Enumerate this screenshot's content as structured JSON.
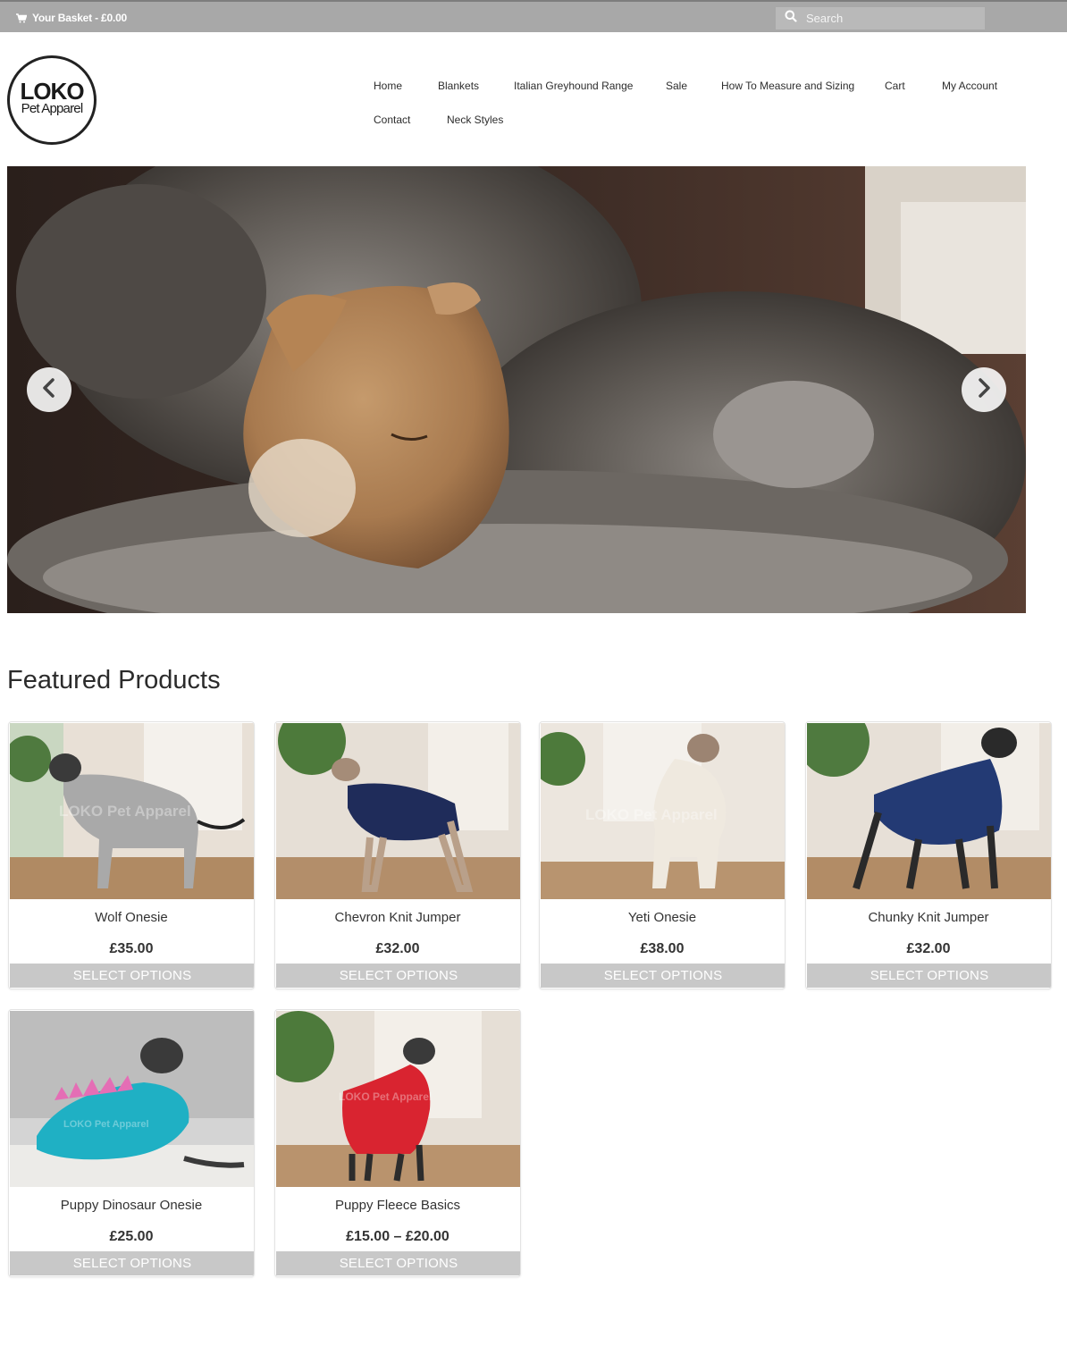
{
  "topbar": {
    "basket_label": "Your Basket - £0.00",
    "search_placeholder": "Search"
  },
  "logo": {
    "line1": "LOKO",
    "line2": "Pet Apparel"
  },
  "nav": {
    "items": [
      "Home",
      "Blankets",
      "Italian Greyhound Range",
      "Sale",
      "How To Measure and Sizing",
      "Cart",
      "My Account",
      "Contact",
      "Neck Styles"
    ]
  },
  "hero": {
    "prev_icon": "chevron-left-icon",
    "next_icon": "chevron-right-icon"
  },
  "featured": {
    "title": "Featured Products",
    "button_label": "SELECT OPTIONS",
    "watermark": "LOKO Pet Apparel",
    "products": [
      {
        "name": "Wolf Onesie",
        "price": "£35.00",
        "garment_color": "#a9a9a9"
      },
      {
        "name": "Chevron Knit Jumper",
        "price": "£32.00",
        "garment_color": "#1f2c5a"
      },
      {
        "name": "Yeti Onesie",
        "price": "£38.00",
        "garment_color": "#efe9df"
      },
      {
        "name": "Chunky Knit Jumper",
        "price": "£32.00",
        "garment_color": "#233a74"
      },
      {
        "name": "Puppy Dinosaur Onesie",
        "price": "£25.00",
        "garment_color": "#1fb0c4"
      },
      {
        "name": "Puppy Fleece Basics",
        "price": "£15.00 – £20.00",
        "garment_color": "#d92430"
      }
    ]
  },
  "colors": {
    "topbar": "#a8a8a8",
    "button": "#c8c8c8"
  }
}
